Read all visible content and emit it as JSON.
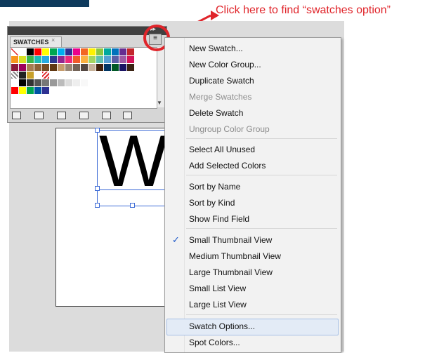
{
  "annotation": {
    "text": "Click here to find “swatches option”"
  },
  "panel": {
    "tab_label": "SWATCHES",
    "close_label": "×",
    "collapse_label": "▸▸",
    "menu_button_icon": "panel-menu-icon"
  },
  "document": {
    "letter": "W"
  },
  "menu": {
    "items": [
      {
        "label": "New Swatch...",
        "enabled": true
      },
      {
        "label": "New Color Group...",
        "enabled": true
      },
      {
        "label": "Duplicate Swatch",
        "enabled": true
      },
      {
        "label": "Merge Swatches",
        "enabled": false
      },
      {
        "label": "Delete Swatch",
        "enabled": true
      },
      {
        "label": "Ungroup Color Group",
        "enabled": false
      },
      {
        "label": "Select All Unused",
        "enabled": true
      },
      {
        "label": "Add Selected Colors",
        "enabled": true
      },
      {
        "label": "Sort by Name",
        "enabled": true
      },
      {
        "label": "Sort by Kind",
        "enabled": true
      },
      {
        "label": "Show Find Field",
        "enabled": true
      },
      {
        "label": "Small Thumbnail View",
        "enabled": true,
        "checked": true
      },
      {
        "label": "Medium Thumbnail View",
        "enabled": true
      },
      {
        "label": "Large Thumbnail View",
        "enabled": true
      },
      {
        "label": "Small List View",
        "enabled": true
      },
      {
        "label": "Large List View",
        "enabled": true
      },
      {
        "label": "Swatch Options...",
        "enabled": true,
        "highlighted": true
      },
      {
        "label": "Spot Colors...",
        "enabled": true
      }
    ],
    "check_mark": "✓"
  },
  "colors": {
    "annotation_red": "#e0242a",
    "title_bar": "#0e3a5c",
    "selection_blue": "#3d6bd6",
    "check_blue": "#1a56c8",
    "disabled_text": "#8c8c8c"
  },
  "swatch_rows": [
    [
      "none",
      "#ffffff",
      "#000000",
      "#ff0000",
      "#ffff00",
      "#00a651",
      "#00aeef",
      "#2e3192",
      "#ec008c",
      "#f26522",
      "#fff200",
      "#8dc63f",
      "#00a99d",
      "#0072bc",
      "#662d91",
      "#c2272d"
    ],
    [
      "#f7941d",
      "#d7df23",
      "#39b54a",
      "#1cbbb4",
      "#27aae1",
      "#2b388f",
      "#92278f",
      "#ee2a7b",
      "#f15a29",
      "#fbb040",
      "#a3d55f",
      "#5fc1b0",
      "#56a0d3",
      "#5b5ea6",
      "#a05aa5",
      "#d4145a"
    ],
    [
      "#8b1a3a",
      "#9e005d",
      "#a67c52",
      "#8c6239",
      "#754c24",
      "#603813",
      "#c69c6d",
      "#998675",
      "#736357",
      "#534741",
      "#c7b299",
      "#42210b",
      "#003663",
      "#005826",
      "#1b1464",
      "#3b2314"
    ],
    [
      "pattern",
      "#222222",
      "#c8a02a",
      "#ffffff",
      "pattern2"
    ],
    [
      "#ffffff",
      "#000000",
      "#333333",
      "#555555",
      "#777777",
      "#999999",
      "#bbbbbb",
      "#dddddd",
      "#eeeeee",
      "#f8f8f8"
    ],
    [
      "#ff0000",
      "#ffff00",
      "#00a651",
      "#0054a6",
      "#2e3192"
    ]
  ]
}
